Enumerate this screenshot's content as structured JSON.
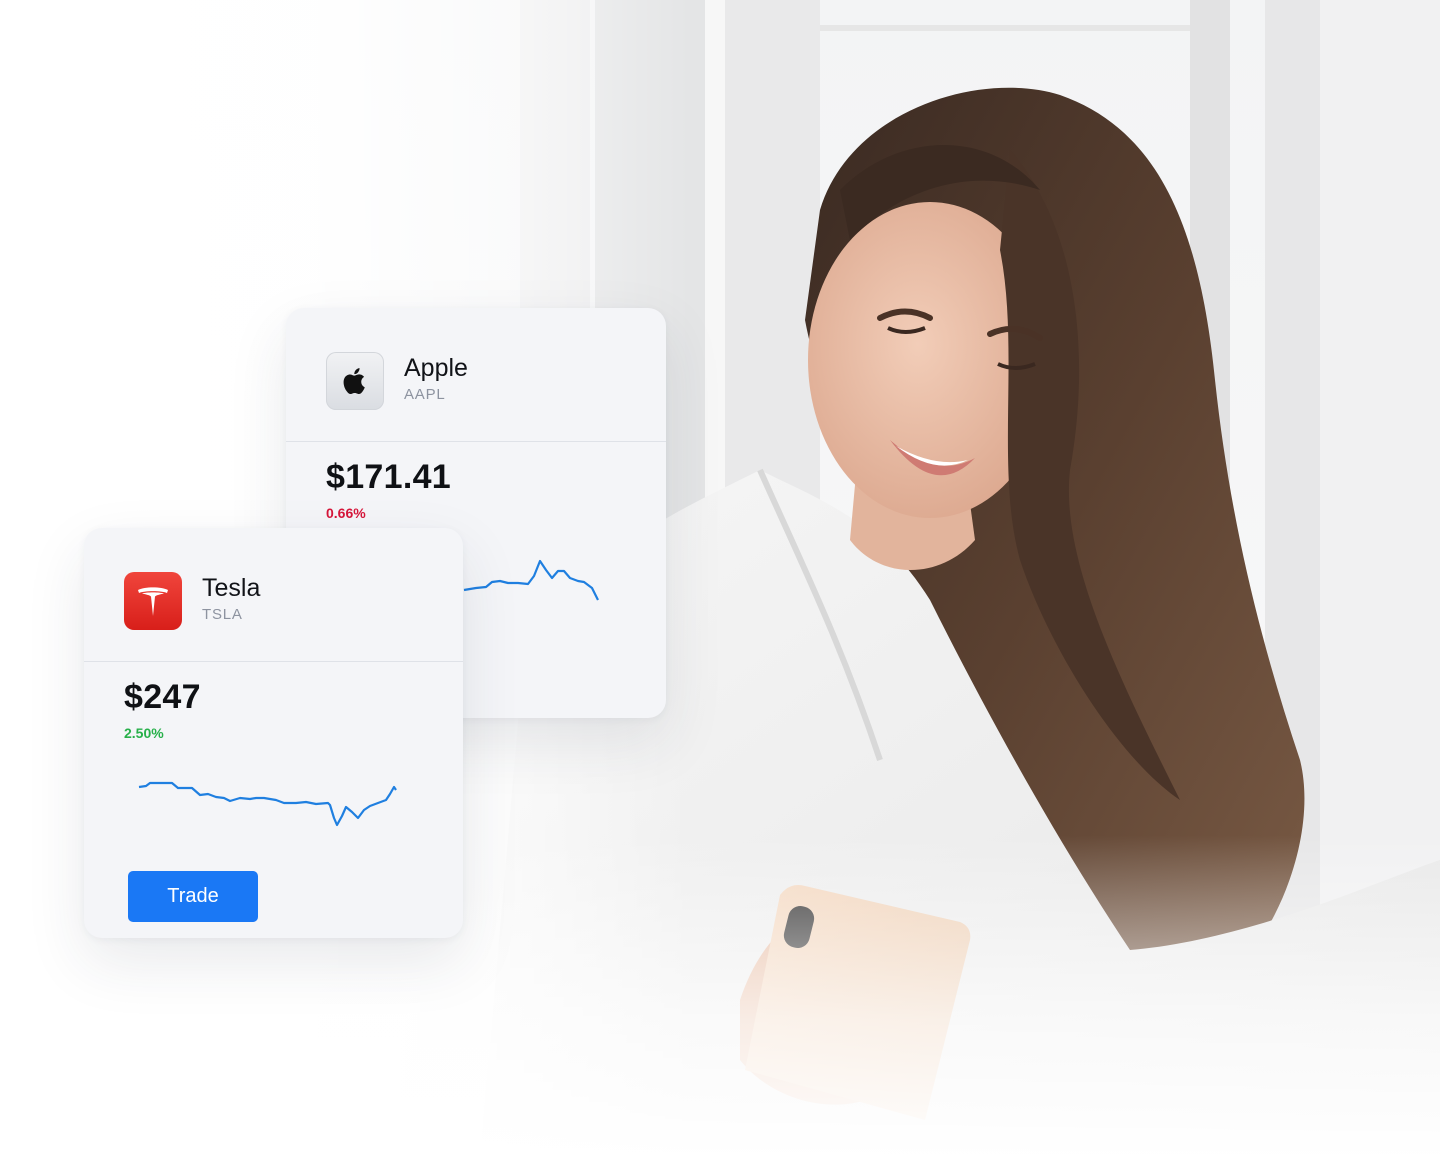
{
  "cards": [
    {
      "name": "Apple",
      "ticker": "AAPL",
      "price": "$171.41",
      "change": "0.66%",
      "change_color": "#d6163a",
      "logo_icon": "apple-logo-icon",
      "sparkline_color": "#1f7fe0"
    },
    {
      "name": "Tesla",
      "ticker": "TSLA",
      "price": "$247",
      "change": "2.50%",
      "change_color": "#27b04a",
      "logo_icon": "tesla-logo-icon",
      "sparkline_color": "#1f7fe0"
    }
  ],
  "trade_button": {
    "label": "Trade",
    "color": "#1a78f5"
  }
}
